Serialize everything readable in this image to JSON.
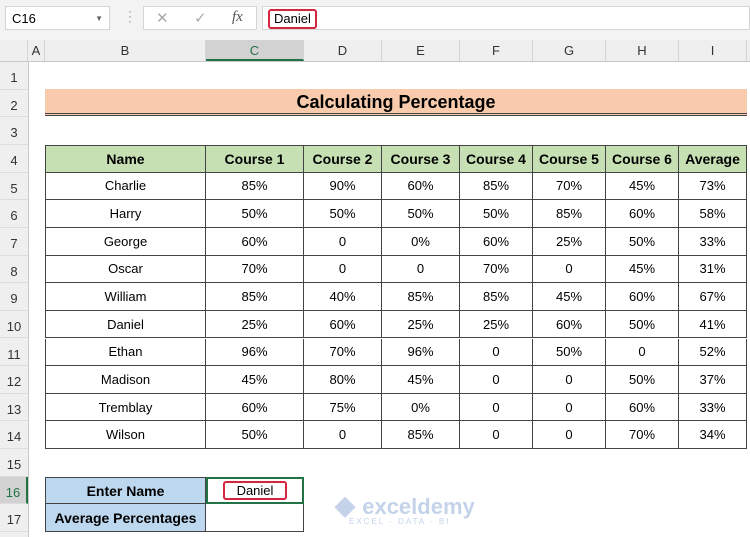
{
  "name_box": "C16",
  "formula_value": "Daniel",
  "formula_icons": [
    "cancel-icon",
    "enter-icon",
    "function-icon"
  ],
  "fx_label": "fx",
  "columns": [
    "A",
    "B",
    "C",
    "D",
    "E",
    "F",
    "G",
    "H",
    "I"
  ],
  "rows": [
    "1",
    "2",
    "3",
    "4",
    "5",
    "6",
    "7",
    "8",
    "9",
    "10",
    "11",
    "12",
    "13",
    "14",
    "15",
    "16",
    "17"
  ],
  "title": "Calculating Percentage",
  "headers": [
    "Name",
    "Course 1",
    "Course 2",
    "Course 3",
    "Course 4",
    "Course 5",
    "Course 6",
    "Average"
  ],
  "data": [
    [
      "Charlie",
      "85%",
      "90%",
      "60%",
      "85%",
      "70%",
      "45%",
      "73%"
    ],
    [
      "Harry",
      "50%",
      "50%",
      "50%",
      "50%",
      "85%",
      "60%",
      "58%"
    ],
    [
      "George",
      "60%",
      "0",
      "0%",
      "60%",
      "25%",
      "50%",
      "33%"
    ],
    [
      "Oscar",
      "70%",
      "0",
      "0",
      "70%",
      "0",
      "45%",
      "31%"
    ],
    [
      "William",
      "85%",
      "40%",
      "85%",
      "85%",
      "45%",
      "60%",
      "67%"
    ],
    [
      "Daniel",
      "25%",
      "60%",
      "25%",
      "25%",
      "60%",
      "50%",
      "41%"
    ],
    [
      "Ethan",
      "96%",
      "70%",
      "96%",
      "0",
      "50%",
      "0",
      "52%"
    ],
    [
      "Madison",
      "45%",
      "80%",
      "45%",
      "0",
      "0",
      "50%",
      "37%"
    ],
    [
      "Tremblay",
      "60%",
      "75%",
      "0%",
      "0",
      "0",
      "60%",
      "33%"
    ],
    [
      "Wilson",
      "50%",
      "0",
      "85%",
      "0",
      "0",
      "70%",
      "34%"
    ]
  ],
  "lookup": {
    "label1": "Enter Name",
    "value1": "Daniel",
    "label2": "Average Percentages",
    "value2": ""
  },
  "watermark": {
    "brand": "exceldemy",
    "tagline": "EXCEL - DATA - BI"
  },
  "colors": {
    "header_green": "#c6e0b4",
    "title_orange": "#f8cbad",
    "label_blue": "#bdd7ee",
    "highlight_red": "#d6263f",
    "excel_green": "#217346"
  }
}
